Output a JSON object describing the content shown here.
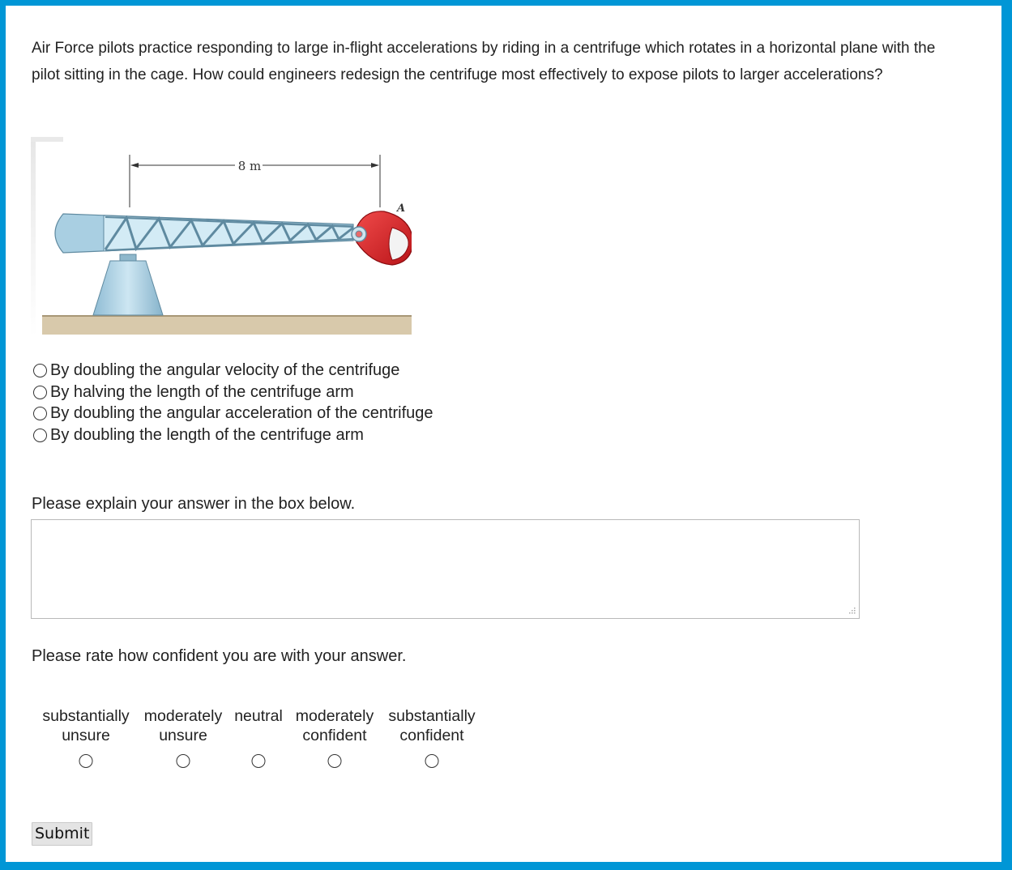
{
  "question": {
    "text": "Air Force pilots practice responding to large in-flight accelerations by riding in a centrifuge which rotates in a horizontal plane with the pilot sitting in the cage. How could engineers redesign the centrifuge most effectively to  expose pilots to larger accelerations?"
  },
  "figure": {
    "dimension_label": "8 m",
    "point_label": "A",
    "colors": {
      "structure": "#a9cfe2",
      "cage": "#d9262b",
      "ground": "#d8c9ab"
    }
  },
  "options": [
    {
      "label": "By doubling the angular velocity of the centrifuge"
    },
    {
      "label": "By halving the length of the centrifuge  arm"
    },
    {
      "label": "By doubling the angular acceleration of the centrifuge"
    },
    {
      "label": "By doubling the length of the centrifuge arm"
    }
  ],
  "explain": {
    "label": "Please explain your answer in the box below.",
    "value": ""
  },
  "confidence": {
    "label": "Please rate how confident you are with your answer.",
    "scale": [
      {
        "line1": "substantially",
        "line2": "unsure"
      },
      {
        "line1": "moderately",
        "line2": "unsure"
      },
      {
        "line1": "neutral",
        "line2": ""
      },
      {
        "line1": "moderately",
        "line2": "confident"
      },
      {
        "line1": "substantially",
        "line2": "confident"
      }
    ]
  },
  "submit_label": "Submit",
  "theme": {
    "border": "#0096d6",
    "background": "#ffffff"
  }
}
